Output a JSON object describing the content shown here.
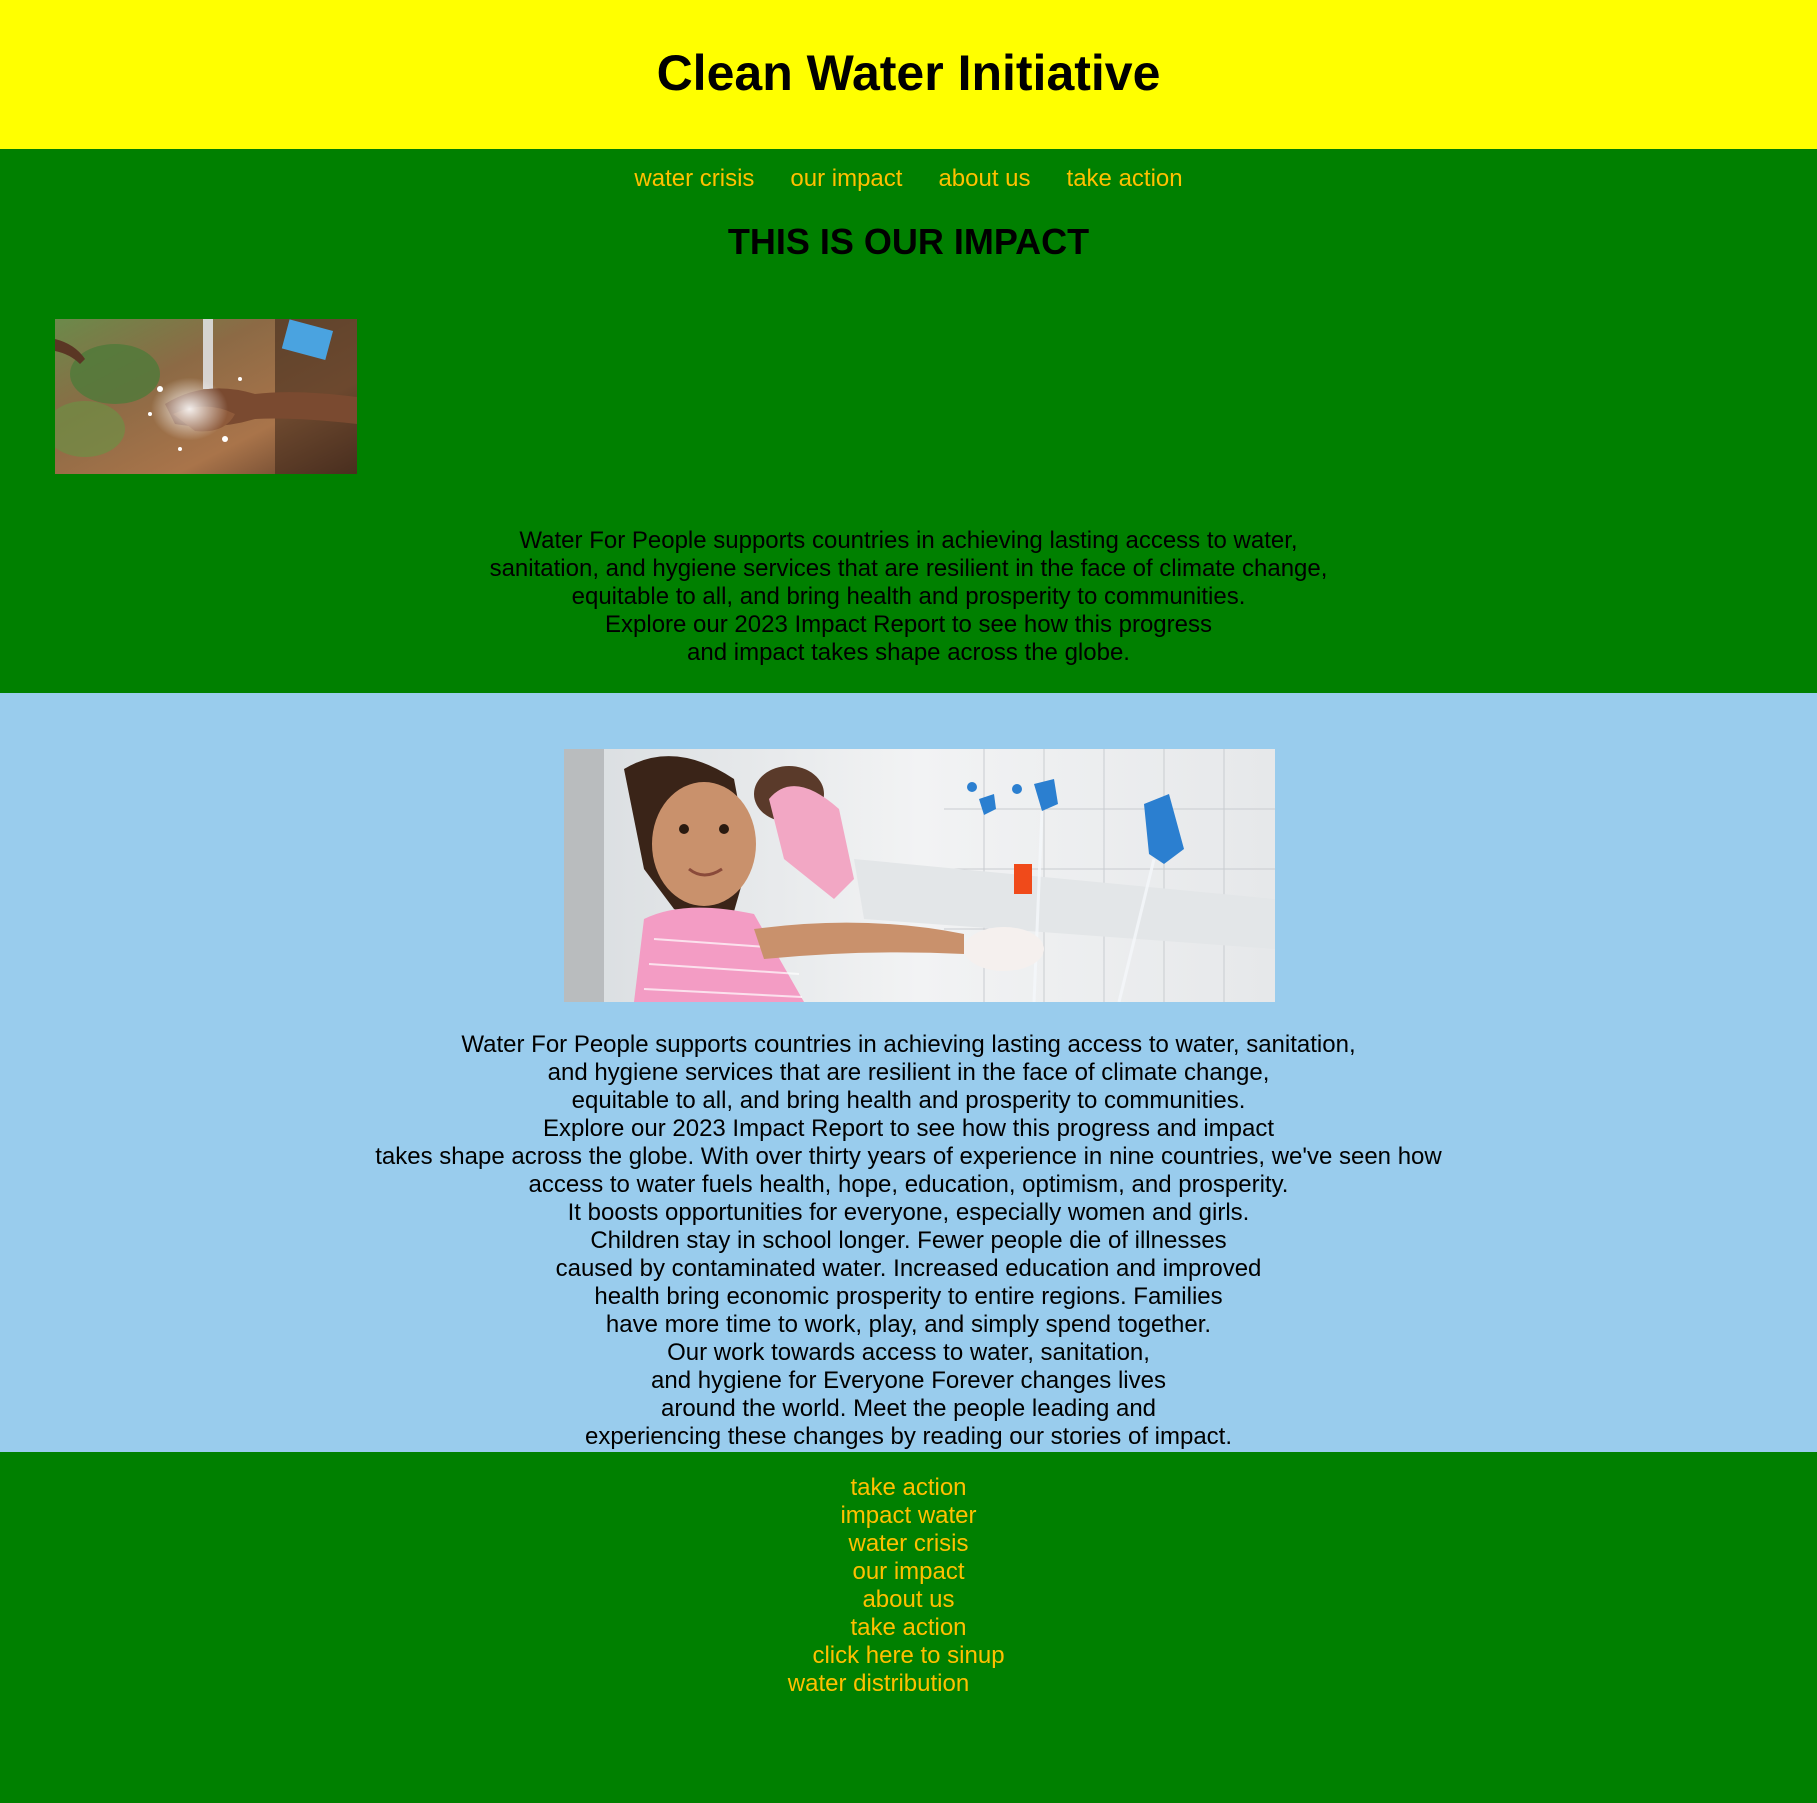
{
  "header": {
    "title": "Clean Water Initiative"
  },
  "nav": {
    "items": [
      {
        "label": "water crisis"
      },
      {
        "label": "our impact"
      },
      {
        "label": "about us"
      },
      {
        "label": "take action"
      }
    ]
  },
  "impact": {
    "title": "THIS IS OUR IMPACT",
    "image_alt": "hands under running water",
    "text": "Water For People supports countries in achieving lasting access to water,\nsanitation, and hygiene services that are resilient in the face of climate change,\nequitable to all, and bring health and prosperity to communities.\nExplore our 2023 Impact Report to see how this progress\nand impact takes shape across the globe."
  },
  "story": {
    "image_alt": "girl washing hands at a row of blue taps",
    "text": "Water For People supports countries in achieving lasting access to water, sanitation,\nand hygiene services that are resilient in the face of climate change,\nequitable to all, and bring health and prosperity to communities.\nExplore our 2023 Impact Report to see how this progress and impact\ntakes shape across the globe. With over thirty years of experience in nine countries, we've seen how\naccess to water fuels health, hope, education, optimism, and prosperity.\nIt boosts opportunities for everyone, especially women and girls.\nChildren stay in school longer. Fewer people die of illnesses\ncaused by contaminated water. Increased education and improved\nhealth bring economic prosperity to entire regions. Families\nhave more time to work, play, and simply spend together.\nOur work towards access to water, sanitation,\nand hygiene for Everyone Forever changes lives\naround the world. Meet the people leading and\nexperiencing these changes by reading our stories of impact."
  },
  "footer": {
    "links": [
      {
        "label": "take action"
      },
      {
        "label": "impact water"
      },
      {
        "label": "water crisis"
      },
      {
        "label": "our impact"
      },
      {
        "label": "about us"
      },
      {
        "label": "take action"
      },
      {
        "label": "click here to sinup"
      },
      {
        "label": "water distribution"
      }
    ]
  },
  "colors": {
    "header_bg": "#ffff00",
    "section_green": "#008000",
    "section_blue": "#99cced",
    "link": "#ffc000"
  }
}
